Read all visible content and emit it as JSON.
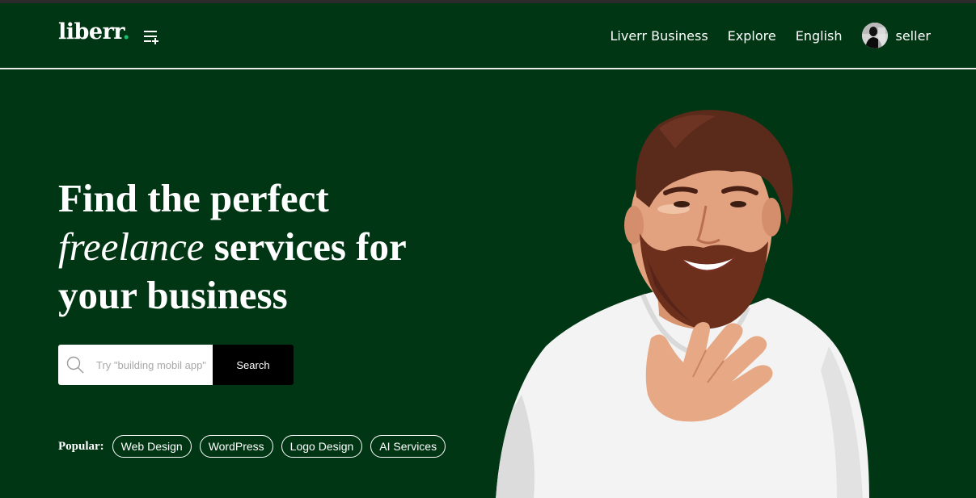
{
  "nav": {
    "logo_text": "liberr",
    "logo_dot": ".",
    "links": [
      "Liverr Business",
      "Explore",
      "English"
    ],
    "user_name": "seller"
  },
  "hero": {
    "headline_line1": "Find the perfect",
    "headline_italic": "freelance",
    "headline_line2_rest": " services for",
    "headline_line3": "your business",
    "search": {
      "placeholder": "Try \"building mobil app\"",
      "value": "",
      "button_label": "Search"
    },
    "popular_label": "Popular:",
    "popular_tags": [
      "Web Design",
      "WordPress",
      "Logo Design",
      "AI Services"
    ]
  },
  "icons": {
    "menu": "menu-plus-icon",
    "search": "search-icon",
    "avatar": "user-avatar",
    "hero": "hero-person-image"
  },
  "colors": {
    "background": "#003614",
    "accent": "#1dbf73",
    "button": "#000000",
    "text": "#ffffff"
  }
}
